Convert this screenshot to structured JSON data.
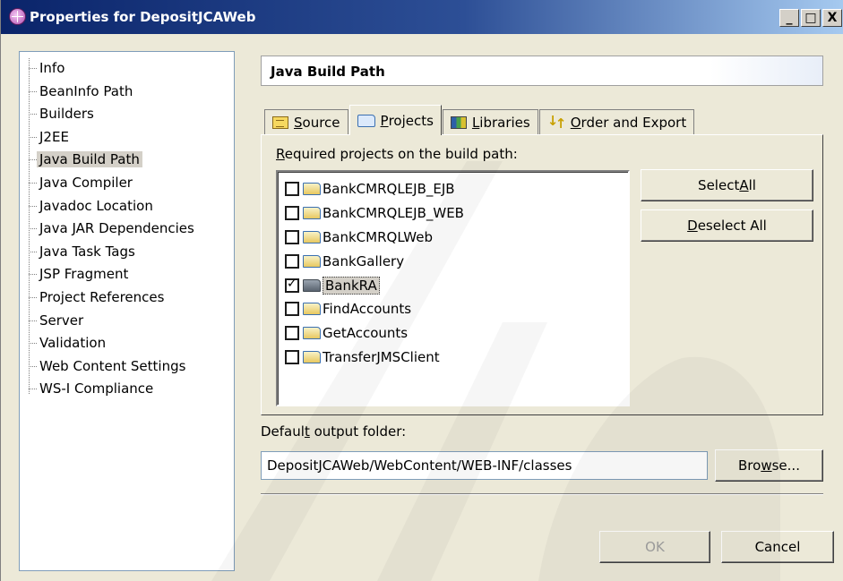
{
  "window": {
    "title": "Properties for DepositJCAWeb",
    "minimize": "_",
    "maximize": "□",
    "close": "X"
  },
  "tree": {
    "items": [
      "Info",
      "BeanInfo Path",
      "Builders",
      "J2EE",
      "Java Build Path",
      "Java Compiler",
      "Javadoc Location",
      "Java JAR Dependencies",
      "Java Task Tags",
      "JSP Fragment",
      "Project References",
      "Server",
      "Validation",
      "Web Content Settings",
      "WS-I Compliance"
    ],
    "selected": "Java Build Path"
  },
  "page": {
    "title": "Java Build Path"
  },
  "tabs": [
    {
      "pre": "",
      "ul": "S",
      "post": "ource",
      "icon": "source-icon"
    },
    {
      "pre": "",
      "ul": "P",
      "post": "rojects",
      "icon": "projects-folder-icon",
      "active": true
    },
    {
      "pre": "",
      "ul": "L",
      "post": "ibraries",
      "icon": "libraries-icon"
    },
    {
      "pre": "",
      "ul": "O",
      "post": "rder and Export",
      "icon": "order-export-icon"
    }
  ],
  "projects": {
    "label_ul": "R",
    "label_rest": "equired projects on the build path:",
    "items": [
      {
        "name": "BankCMRQLEJB_EJB",
        "checked": false
      },
      {
        "name": "BankCMRQLEJB_WEB",
        "checked": false
      },
      {
        "name": "BankCMRQLWeb",
        "checked": false
      },
      {
        "name": "BankGallery",
        "checked": false
      },
      {
        "name": "BankRA",
        "checked": true,
        "closed": true,
        "selected": true
      },
      {
        "name": "FindAccounts",
        "checked": false
      },
      {
        "name": "GetAccounts",
        "checked": false
      },
      {
        "name": "TransferJMSClient",
        "checked": false
      }
    ],
    "select_all": {
      "pre": "Select ",
      "ul": "A",
      "post": "ll"
    },
    "deselect_all": {
      "pre": "",
      "ul": "D",
      "post": "eselect All"
    }
  },
  "output": {
    "label_pre": "Defaul",
    "label_ul": "t",
    "label_post": " output folder:",
    "value": "DepositJCAWeb/WebContent/WEB-INF/classes",
    "browse": {
      "pre": "Bro",
      "ul": "w",
      "post": "se..."
    }
  },
  "footer": {
    "ok": "OK",
    "cancel": "Cancel"
  }
}
